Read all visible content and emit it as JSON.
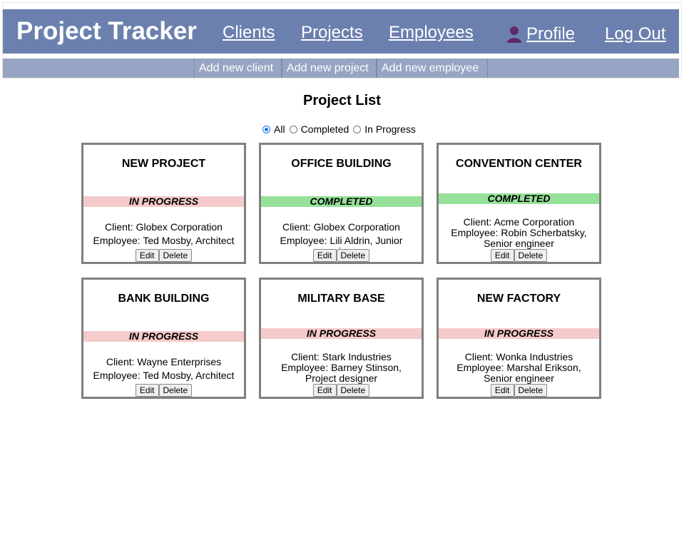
{
  "header": {
    "brand": "Project Tracker",
    "nav": {
      "clients": "Clients",
      "projects": "Projects",
      "employees": "Employees",
      "profile": "Profile",
      "logout": "Log Out"
    }
  },
  "subnav": {
    "add_client": "Add new client",
    "add_project": "Add new project",
    "add_employee": "Add new employee"
  },
  "page": {
    "title": "Project List"
  },
  "filter": {
    "selected": "All",
    "options": [
      "All",
      "Completed",
      "In Progress"
    ]
  },
  "projects": [
    {
      "name": "NEW PROJECT",
      "status": "IN PROGRESS",
      "client": "Client: Globex Corporation",
      "employee": "Employee: Ted Mosby, Architect"
    },
    {
      "name": "OFFICE BUILDING",
      "status": "COMPLETED",
      "client": "Client: Globex Corporation",
      "employee": "Employee: Lili Aldrin, Junior engineer"
    },
    {
      "name": "CONVENTION CENTER",
      "status": "COMPLETED",
      "client": "Client: Acme Corporation",
      "employee": "Employee: Robin Scherbatsky, Senior engineer"
    },
    {
      "name": "BANK BUILDING",
      "status": "IN PROGRESS",
      "client": "Client: Wayne Enterprises",
      "employee": "Employee: Ted Mosby, Architect"
    },
    {
      "name": "MILITARY BASE",
      "status": "IN PROGRESS",
      "client": "Client: Stark Industries",
      "employee": "Employee: Barney Stinson, Project designer"
    },
    {
      "name": "NEW FACTORY",
      "status": "IN PROGRESS",
      "client": "Client: Wonka Industries",
      "employee": "Employee: Marshal Erikson, Senior engineer"
    }
  ],
  "card_actions": {
    "edit": "Edit",
    "delete": "Delete"
  },
  "colors": {
    "header_bg": "#6b80ae",
    "subnav_bg": "#97a5c4",
    "in_progress": "#f5caca",
    "completed": "#96e09a"
  }
}
